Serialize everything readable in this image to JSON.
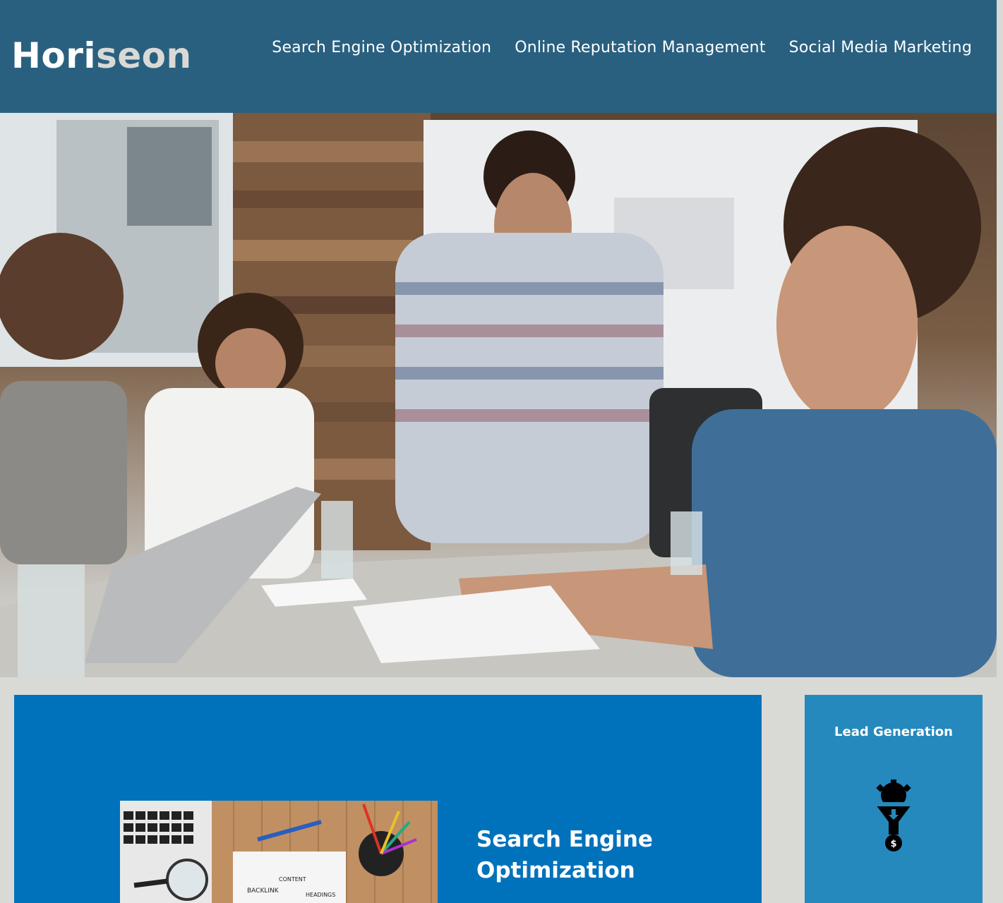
{
  "header": {
    "logo_part1": "Hori",
    "logo_part2": "seon",
    "nav": [
      {
        "label": "Search Engine Optimization"
      },
      {
        "label": "Online Reputation Management"
      },
      {
        "label": "Social Media Marketing"
      }
    ]
  },
  "content": {
    "seo_title": "Search Engine Optimization",
    "seo_image_words": [
      "CONTENT",
      "BACKLINK",
      "HEADINGS"
    ]
  },
  "aside": {
    "lead_title": "Lead Generation",
    "lead_icon": "funnel-gear-dollar-icon"
  },
  "colors": {
    "header_bg": "#2a607f",
    "page_bg": "#d9dad6",
    "content_bg": "#0072bb",
    "aside_bg": "#2589bd"
  }
}
